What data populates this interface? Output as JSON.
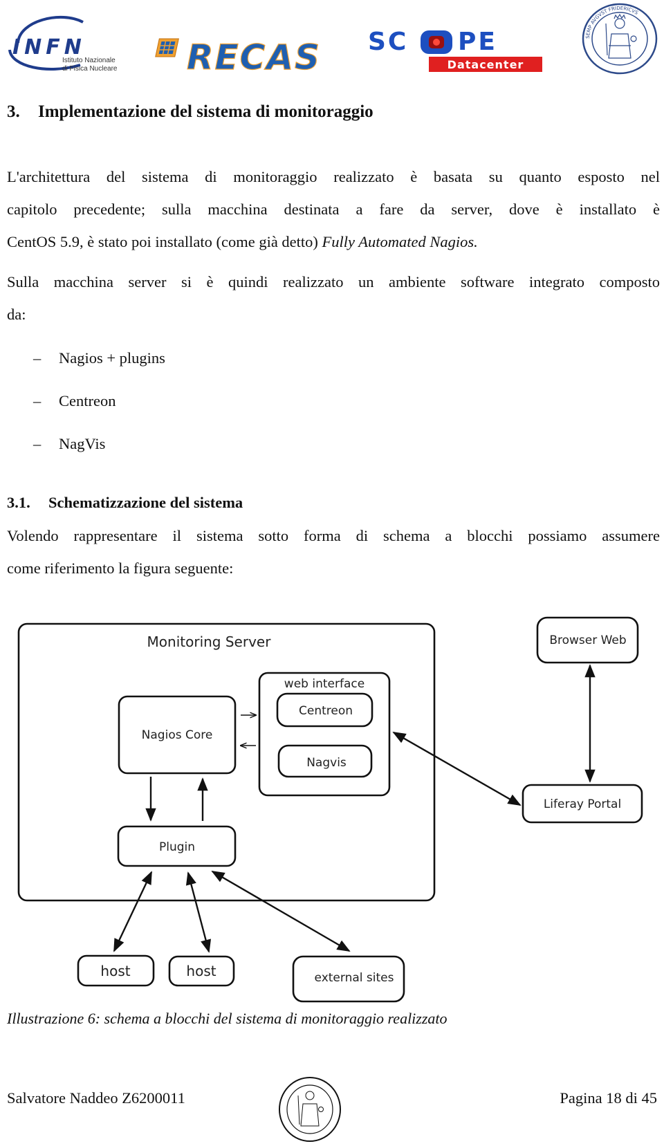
{
  "header": {
    "logos": [
      {
        "name": "INFN",
        "line1": "Istituto Nazionale",
        "line2": "di Fisica Nucleare"
      },
      {
        "name": "RECAS"
      },
      {
        "name": "SCOPE",
        "sub": "Datacenter"
      },
      {
        "name": "Università Federico II seal"
      }
    ],
    "infn_letters": "INFN",
    "infn_line1": "Istituto Nazionale",
    "infn_line2": "di Fisica Nucleare",
    "recas": "RECAS",
    "scope_left": "SC",
    "scope_right": "PE",
    "scope_sub": "Datacenter"
  },
  "section": {
    "number": "3.",
    "title": "Implementazione del sistema di monitoraggio"
  },
  "paragraph1": {
    "lines": [
      "L'architettura del sistema di monitoraggio realizzato è basata su quanto esposto nel",
      "capitolo precedente; sulla macchina destinata a fare da server, dove è installato è"
    ],
    "line3_prefix": "CentOS 5.9, è stato poi installato (come già detto) ",
    "line3_italic": "Fully Automated Nagios."
  },
  "paragraph2": {
    "lines": [
      "Sulla macchina server si è quindi realizzato un ambiente software integrato composto",
      "da:"
    ]
  },
  "list": {
    "bullet": "–",
    "items": [
      "Nagios + plugins",
      "Centreon",
      "NagVis"
    ]
  },
  "subsection": {
    "number": "3.1.",
    "title": "Schematizzazione del sistema"
  },
  "paragraph3": {
    "lines": [
      "Volendo rappresentare il sistema sotto forma di schema a blocchi possiamo assumere",
      "come riferimento la figura seguente:"
    ]
  },
  "diagram": {
    "monitoring_server": "Monitoring Server",
    "web_interface": "web interface",
    "centreon": "Centreon",
    "nagvis": "Nagvis",
    "nagios_core": "Nagios Core",
    "plugin": "Plugin",
    "browser_web": "Browser Web",
    "liferay_portal": "Liferay Portal",
    "host1": "host",
    "host2": "host",
    "external_sites": "external sites"
  },
  "caption": "Illustrazione 6: schema a blocchi del sistema di monitoraggio realizzato",
  "footer": {
    "author": "Salvatore Naddeo Z6200011",
    "page": "Pagina 18 di 45"
  },
  "colors": {
    "infn_blue": "#1f3c8c",
    "recas_blue": "#1f5fb0",
    "recas_orange": "#f0a030",
    "scope_blue": "#1d4fc0",
    "scope_red": "#e02020",
    "seal_blue": "#2d4a8a"
  }
}
